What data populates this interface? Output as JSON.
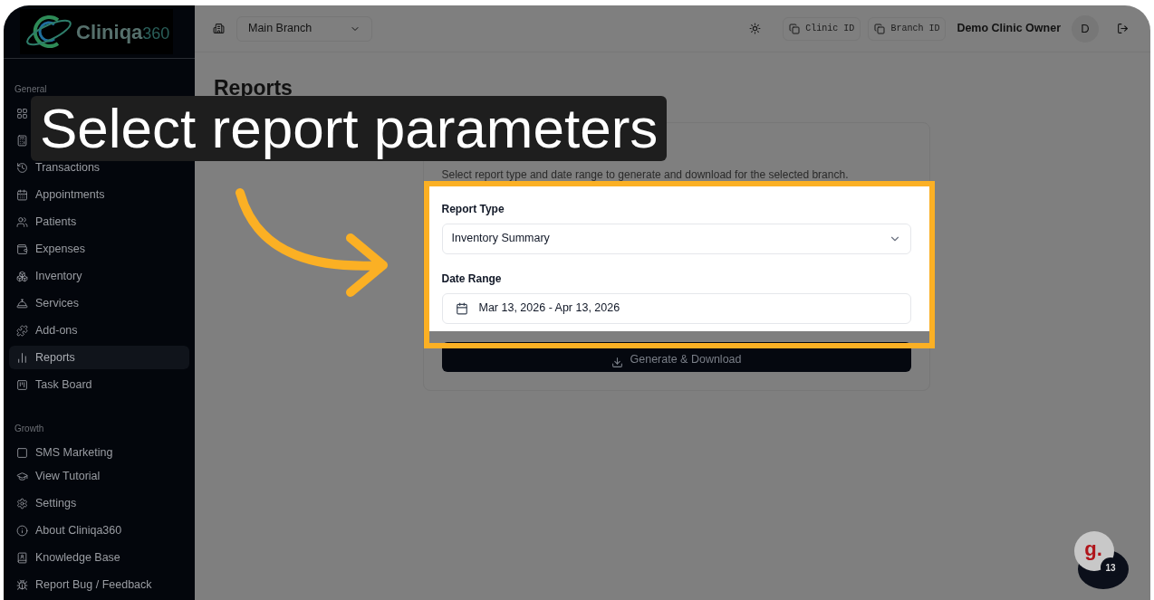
{
  "logo": {
    "text": "Cliniqa",
    "suffix": "360"
  },
  "header": {
    "branch_select": "Main Branch",
    "buttons": [
      "Clinic ID",
      "Branch ID"
    ],
    "user_name": "Demo Clinic Owner",
    "avatar": "D"
  },
  "sidebar": {
    "sections": [
      {
        "heading": "General",
        "items": [
          {
            "selected": false
          },
          {
            "selected": false
          },
          {
            "label": "Transactions",
            "selected": false
          },
          {
            "label": "Appointments",
            "selected": false
          },
          {
            "label": "Patients",
            "selected": false
          },
          {
            "label": "Expenses",
            "selected": false
          },
          {
            "label": "Inventory",
            "selected": false
          },
          {
            "label": "Services",
            "selected": false
          },
          {
            "label": "Add-ons",
            "selected": false
          },
          {
            "label": "Reports",
            "selected": true
          },
          {
            "label": "Task Board",
            "selected": false
          }
        ]
      },
      {
        "heading": "Growth",
        "items": [
          {
            "label": "SMS Marketing",
            "selected": false
          }
        ]
      }
    ],
    "footer_items": [
      "View Tutorial",
      "Settings",
      "About Cliniqa360",
      "Knowledge Base",
      "Report Bug / Feedback"
    ]
  },
  "page": {
    "title": "Reports",
    "card": {
      "description": "Select report type and date range to generate and download for the selected branch.",
      "fields": [
        {
          "kind": "select",
          "label": "Report Type",
          "value": "Inventory Summary"
        },
        {
          "kind": "date",
          "label": "Date Range",
          "value": "Mar 13, 2026 - Apr 13, 2026"
        }
      ],
      "button": "Generate & Download"
    }
  },
  "tutorial": {
    "caption": "Select report parameters"
  },
  "chat_widget": {
    "logo": "g.",
    "count": "13"
  }
}
